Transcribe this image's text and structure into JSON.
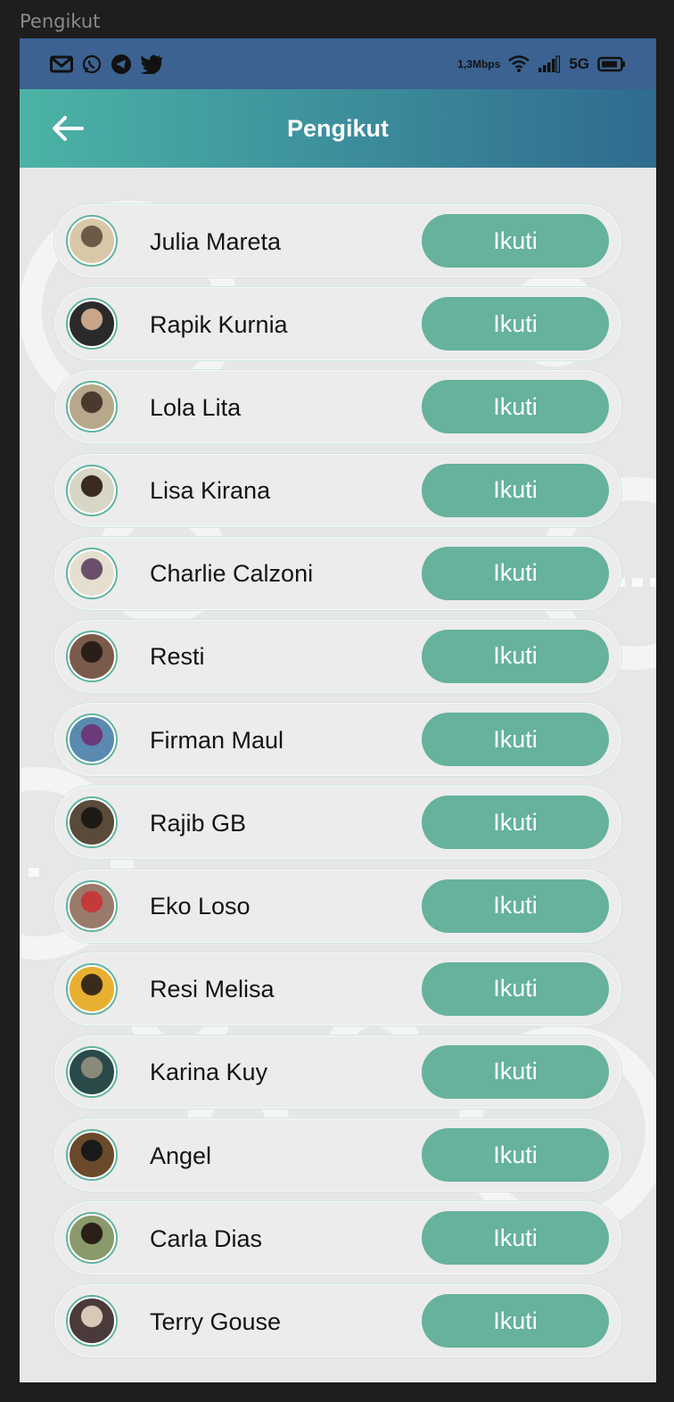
{
  "window": {
    "frame_label": "Pengikut"
  },
  "status_bar": {
    "speed": "1,3Mbps",
    "network": "5G",
    "left_icons": [
      "gmail-icon",
      "whatsapp-icon",
      "telegram-icon",
      "twitter-icon"
    ],
    "right_icons": [
      "wifi-icon",
      "signal-icon",
      "battery-icon"
    ]
  },
  "app_bar": {
    "title": "Pengikut",
    "gradient": [
      "#4cb3a5",
      "#2f6b8e"
    ]
  },
  "colors": {
    "accent": "#66b29c",
    "background": "#e7e7e7",
    "status_bar": "#3b6290"
  },
  "followers": [
    {
      "name": "Julia Mareta",
      "button": "Ikuti",
      "avatar": [
        "#d9c8a8",
        "#6b5a48"
      ]
    },
    {
      "name": "Rapik Kurnia",
      "button": "Ikuti",
      "avatar": [
        "#2a2a2a",
        "#c9a68a"
      ]
    },
    {
      "name": "Lola Lita",
      "button": "Ikuti",
      "avatar": [
        "#b7a88c",
        "#4a3a2e"
      ]
    },
    {
      "name": "Lisa Kirana",
      "button": "Ikuti",
      "avatar": [
        "#d8d6c4",
        "#3a2a20"
      ]
    },
    {
      "name": "Charlie Calzoni",
      "button": "Ikuti",
      "avatar": [
        "#e6dfd0",
        "#6a4f6a"
      ]
    },
    {
      "name": "Resti",
      "button": "Ikuti",
      "avatar": [
        "#7a5a4a",
        "#2a1e18"
      ]
    },
    {
      "name": "Firman Maul",
      "button": "Ikuti",
      "avatar": [
        "#5a8ab0",
        "#6a3a7a"
      ]
    },
    {
      "name": "Rajib GB",
      "button": "Ikuti",
      "avatar": [
        "#5a4a3a",
        "#1e1a16"
      ]
    },
    {
      "name": "Eko Loso",
      "button": "Ikuti",
      "avatar": [
        "#9a7a6a",
        "#c43a3a"
      ]
    },
    {
      "name": "Resi Melisa",
      "button": "Ikuti",
      "avatar": [
        "#e8b030",
        "#3a2a1a"
      ]
    },
    {
      "name": "Karina Kuy",
      "button": "Ikuti",
      "avatar": [
        "#2a4a4a",
        "#8a8a7a"
      ]
    },
    {
      "name": "Angel",
      "button": "Ikuti",
      "avatar": [
        "#6a4a2a",
        "#1a1a1a"
      ]
    },
    {
      "name": "Carla Dias",
      "button": "Ikuti",
      "avatar": [
        "#8a9a6a",
        "#2a2018"
      ]
    },
    {
      "name": "Terry Gouse",
      "button": "Ikuti",
      "avatar": [
        "#4a3a3a",
        "#d8c8b8"
      ]
    }
  ]
}
